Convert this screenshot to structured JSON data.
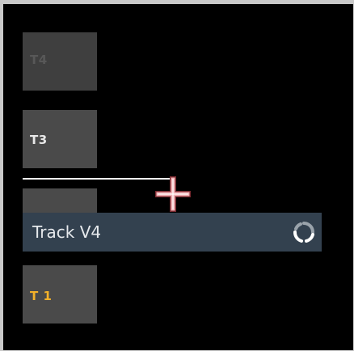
{
  "tracks": {
    "t4": {
      "label": "T4"
    },
    "t3": {
      "label": "T3"
    },
    "t1": {
      "label": "T 1"
    }
  },
  "dragged_track": {
    "name": "Track V4",
    "icon": "sync-icon"
  },
  "cursor": {
    "icon": "move-crosshair-icon"
  },
  "colors": {
    "background": "#000000",
    "track_header": "#4a4a4a",
    "dragged_track": "#33414f",
    "t1_label": "#f3b12a",
    "drop_indicator": "#ffffff",
    "cursor": "#f4a6aa"
  }
}
